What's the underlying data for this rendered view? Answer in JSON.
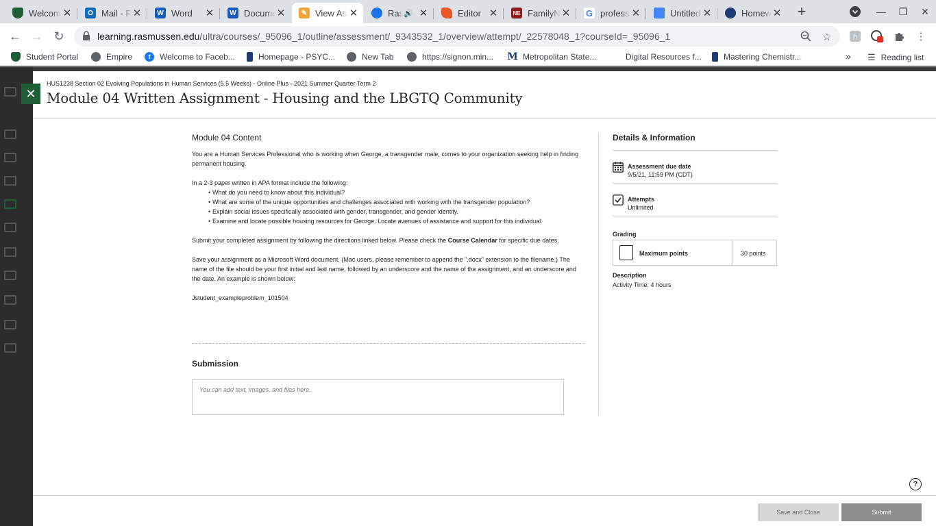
{
  "browser": {
    "tabs": [
      {
        "title": "Welcome",
        "icon": "rasmussen-shield-icon",
        "color": "#1d5e36"
      },
      {
        "title": "Mail - R",
        "icon": "outlook-icon",
        "color": "#0f6cbd"
      },
      {
        "title": "Word",
        "icon": "word-icon",
        "color": "#185abd"
      },
      {
        "title": "Document",
        "icon": "word-doc-icon",
        "color": "#185abd"
      },
      {
        "title": "View Assessment",
        "icon": "pencil-icon",
        "color": "#f2a33a",
        "active": true
      },
      {
        "title": "Ras",
        "icon": "rasmussen-butterfly-icon",
        "color": "#1a73e8",
        "audio": true
      },
      {
        "title": "Editor",
        "icon": "editor-icon",
        "color": "#e8562a"
      },
      {
        "title": "FamilyNE",
        "icon": "ne-logo-icon",
        "color": "#8b1a1a"
      },
      {
        "title": "professional",
        "icon": "google-icon",
        "color": "#4285f4"
      },
      {
        "title": "Untitled",
        "icon": "docs-icon",
        "color": "#4285f4"
      },
      {
        "title": "Homework",
        "icon": "mastering-icon",
        "color": "#1f3b73"
      }
    ],
    "url_host": "learning.rasmussen.edu",
    "url_path": "/ultra/courses/_95096_1/outline/assessment/_9343532_1/overview/attempt/_22578048_1?courseId=_95096_1",
    "bookmarks": [
      {
        "label": "Student Portal",
        "icon": "shield-icon",
        "color": "#1d5e36"
      },
      {
        "label": "Empire",
        "icon": "globe-icon",
        "color": "#5f6368"
      },
      {
        "label": "Welcome to Faceb...",
        "icon": "facebook-icon",
        "color": "#1877f2"
      },
      {
        "label": "Homepage - PSYC...",
        "icon": "bookmark-icon",
        "color": "#1f3b73"
      },
      {
        "label": "New Tab",
        "icon": "globe-icon",
        "color": "#5f6368"
      },
      {
        "label": "https://signon.min...",
        "icon": "globe-icon",
        "color": "#5f6368"
      },
      {
        "label": "Metropolitan State...",
        "icon": "m-logo-icon",
        "color": "#1f3b73"
      },
      {
        "label": "Digital Resources f...",
        "icon": "blank-icon",
        "color": "#ffffff"
      },
      {
        "label": "Mastering Chemistr...",
        "icon": "bookmark-icon",
        "color": "#1f3b73"
      }
    ],
    "overflow": "»",
    "reading_list": "Reading list",
    "extension_badge": "!"
  },
  "page": {
    "course": "HUS1238 Section 02 Evolving Populations in Human Services (5.5 Weeks) - Online Plus - 2021 Summer Quarter Term 2",
    "title": "Module 04 Written Assignment - Housing and the LBGTQ Community",
    "content": {
      "module": "Module 04 Content",
      "intro": "You are a Human Services Professional who is working when George, a transgender male, comes to your organization seeking help in finding permanent housing.",
      "list_intro": "In a 2-3 paper written in APA format include the following:",
      "bullets": [
        "What do you need to know about this individual?",
        "What are some of the unique opportunities and challenges associated with working with the transgender population?",
        "Explain social issues specifically associated with gender, transgender, and gender identity.",
        "Examine and locate possible housing resources for George. Locate avenues of assistance and support for this individual."
      ],
      "submit_pre": "Submit your completed assignment by following the directions linked below. Please check the ",
      "submit_link": "Course Calendar",
      "submit_post": " for specific due dates.",
      "save_text": "Save your assignment as a Microsoft Word document. (Mac users, please remember to append the \".docx\" extension to the filename.) The name of the file should be your first initial and last name, followed by an underscore and the name of the assignment, and an underscore and the date. An example is shown below:",
      "example": "Jstudent_exampleproblem_101504"
    },
    "submission": {
      "heading": "Submission",
      "placeholder": "You can add text, images, and files here."
    },
    "details": {
      "heading": "Details & Information",
      "due_label": "Assessment due date",
      "due_value": "9/5/21, 11:59 PM (CDT)",
      "attempts_label": "Attempts",
      "attempts_value": "Unlimited",
      "grading_label": "Grading",
      "max_points_label": "Maximum points",
      "max_points_value": "30 points",
      "description_label": "Description",
      "description_value": "Activity Time: 4 hours"
    },
    "footer": {
      "save_close": "Save and Close",
      "submit": "Submit"
    },
    "colors": {
      "accent": "#1d5e36",
      "submit_bg": "#8c8c8c",
      "save_bg": "#d6d6d6"
    }
  }
}
